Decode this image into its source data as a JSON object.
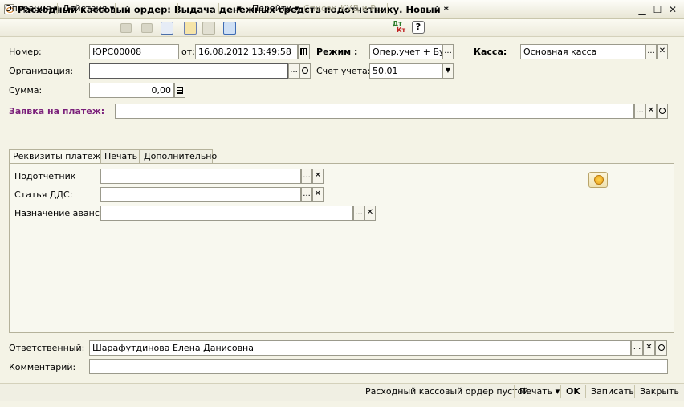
{
  "window": {
    "title": "Расходный кассовый ордер: Выдача денежных средств подотчетнику. Новый *",
    "minimize": "▁",
    "maximize": "☐",
    "close": "✕"
  },
  "toolbar": {
    "operation": "Операция",
    "actions": "Действия",
    "goto": "Перейти",
    "list": "Список",
    "kud": "КУД и Р...",
    "dtkt_top": "Дт",
    "dtkt_bottom": "Кт",
    "help": "?"
  },
  "header": {
    "number_label": "Номер:",
    "number_value": "ЮРС00008",
    "date_label": "от:",
    "date_value": "16.08.2012 13:49:58",
    "mode_label": "Режим :",
    "mode_value": "Опер.учет + Бух.у...",
    "cash_label": "Касса:",
    "cash_value": "Основная касса",
    "org_label": "Организация:",
    "org_value": "",
    "account_label": "Счет учета:",
    "account_value": "50.01",
    "sum_label": "Сумма:",
    "sum_value": "0,00",
    "request_label": "Заявка на платеж:",
    "request_value": ""
  },
  "tabs": [
    {
      "label": "Реквизиты платежа"
    },
    {
      "label": "Печать"
    },
    {
      "label": "Дополнительно"
    }
  ],
  "payment": {
    "person_label": "Подотчетник",
    "person_value": "",
    "dds_label": "Статья ДДС:",
    "dds_value": "",
    "purpose_label": "Назначение аванса:",
    "purpose_value": ""
  },
  "footer": {
    "responsible_label": "Ответственный:",
    "responsible_value": "Шарафутдинова Елена Данисовна",
    "comment_label": "Комментарий:",
    "comment_value": ""
  },
  "bottom": {
    "empty_order": "Расходный кассовый ордер пустой",
    "print": "Печать",
    "ok": "OK",
    "save": "Записать",
    "close": "Закрыть"
  },
  "glyphs": {
    "ellipsis": "...",
    "clear": "✕",
    "dropdown": "▼",
    "menu_arrow": "▾"
  },
  "colors": {
    "request_label": "#7a1f7a",
    "title_bar": "#e8e6d4",
    "accent_icon": "#e8a020"
  }
}
